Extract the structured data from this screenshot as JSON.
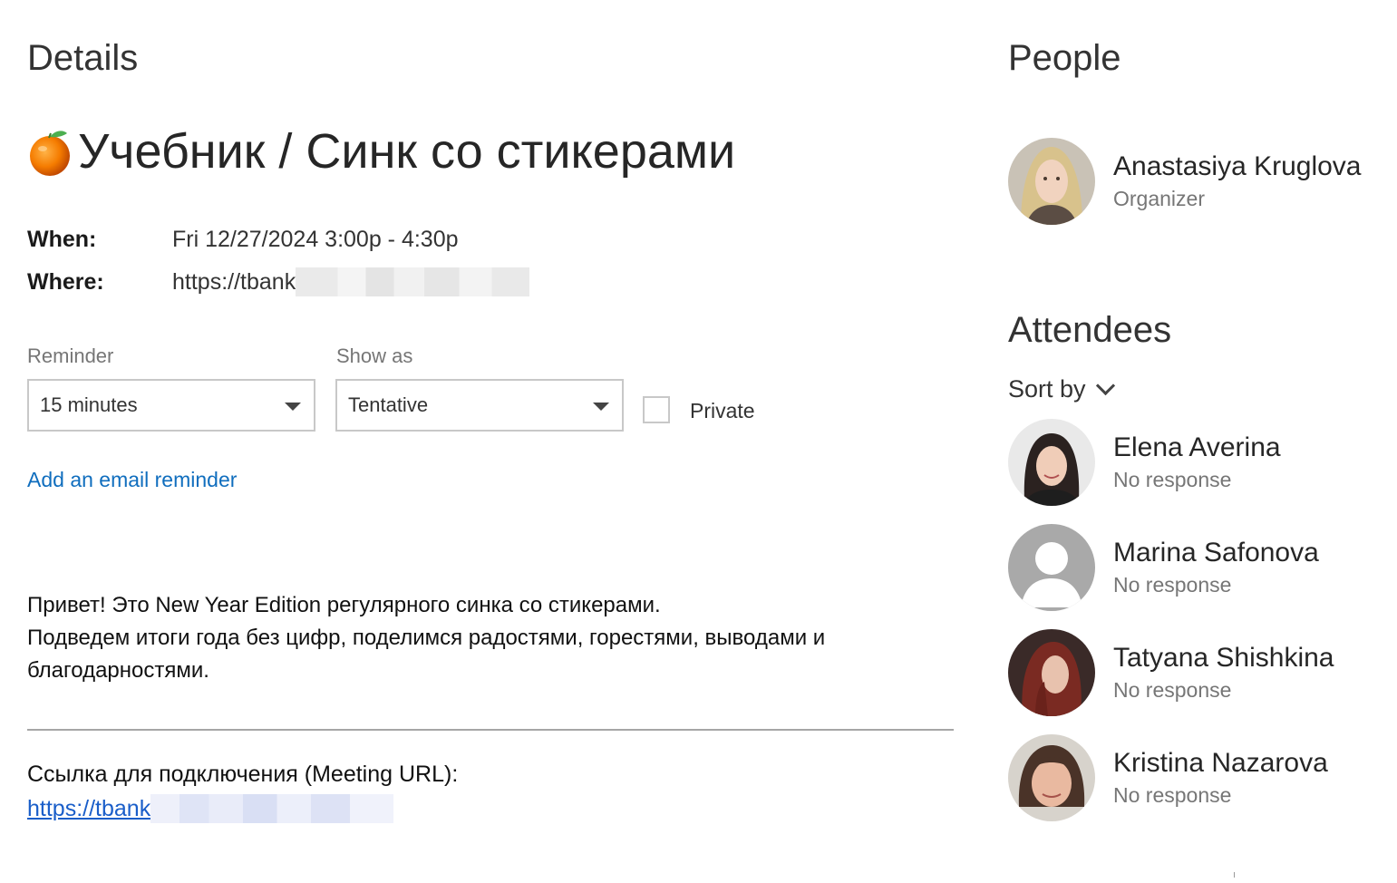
{
  "details": {
    "title": "Details",
    "event_title": "Учебник / Синк со стикерами",
    "event_icon": "orange-fruit-icon",
    "when_label": "When:",
    "when_value": "Fri 12/27/2024 3:00p - 4:30p",
    "where_label": "Where:",
    "where_value": "https://tbank"
  },
  "controls": {
    "reminder_label": "Reminder",
    "reminder_value": "15 minutes",
    "show_as_label": "Show as",
    "show_as_value": "Tentative",
    "private_label": "Private",
    "private_checked": false,
    "email_reminder_link": "Add an email reminder"
  },
  "body": {
    "lines": [
      "Привет! Это New Year Edition регулярного синка со стикерами.",
      "Подведем итоги года без цифр, поделимся радостями, горестями, выводами и",
      "благодарностями."
    ],
    "meeting_url_label": "Ссылка для подключения (Meeting URL):",
    "meeting_url": "https://tbank"
  },
  "people": {
    "title": "People",
    "organizer": {
      "name": "Anastasiya Kruglova",
      "role": "Organizer"
    }
  },
  "attendees": {
    "title": "Attendees",
    "sort_label": "Sort by",
    "list": [
      {
        "name": "Elena Averina",
        "status": "No response"
      },
      {
        "name": "Marina Safonova",
        "status": "No response"
      },
      {
        "name": "Tatyana Shishkina",
        "status": "No response"
      },
      {
        "name": "Kristina Nazarova",
        "status": "No response"
      }
    ]
  },
  "colors": {
    "link": "#106ebe",
    "meeting_link": "#1a5ec9",
    "muted_text": "#767676",
    "border": "#c8c8c8"
  }
}
